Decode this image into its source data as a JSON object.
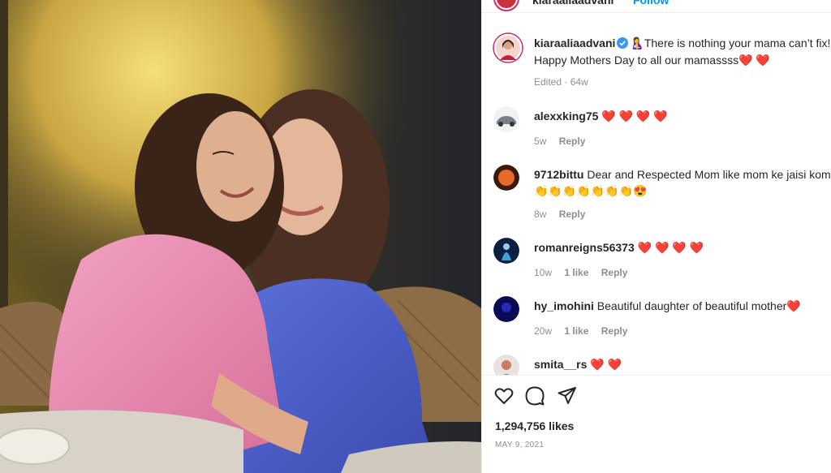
{
  "post": {
    "author": "kiaraaliaadvani",
    "follow_label": "Follow",
    "caption_line1": "🤱There is nothing your mama can’t fix!",
    "caption_line2": "Happy Mothers Day to all our mamassss",
    "caption_hearts": "❤️ ❤️",
    "caption_meta": "Edited · 64w",
    "likes": "1,294,756 likes",
    "date": "MAY 9, 2021"
  },
  "comments": [
    {
      "user": "alexxking75",
      "text": "❤️ ❤️ ❤️ ❤️",
      "text2": "",
      "time": "5w",
      "likes": "",
      "reply": "Reply"
    },
    {
      "user": "9712bittu",
      "text": "Dear and Respected Mom like mom ke jaisi komal",
      "text2": "👏👏👏👏👏👏👏😍",
      "time": "8w",
      "likes": "",
      "reply": "Reply"
    },
    {
      "user": "romanreigns56373",
      "text": "❤️ ❤️ ❤️ ❤️",
      "text2": "",
      "time": "10w",
      "likes": "1 like",
      "reply": "Reply"
    },
    {
      "user": "hy_imohini",
      "text": "Beautiful daughter of beautiful mother❤️",
      "text2": "",
      "time": "20w",
      "likes": "1 like",
      "reply": "Reply"
    },
    {
      "user": "smita__rs",
      "text": "❤️ ❤️",
      "text2": "",
      "time": "",
      "likes": "",
      "reply": ""
    }
  ],
  "colors": {
    "accent": "#0095f6",
    "heart": "#ed1c24",
    "muted": "#8e8e8e"
  },
  "icons": [
    "heart-icon",
    "comment-icon",
    "share-icon",
    "verified-icon"
  ]
}
